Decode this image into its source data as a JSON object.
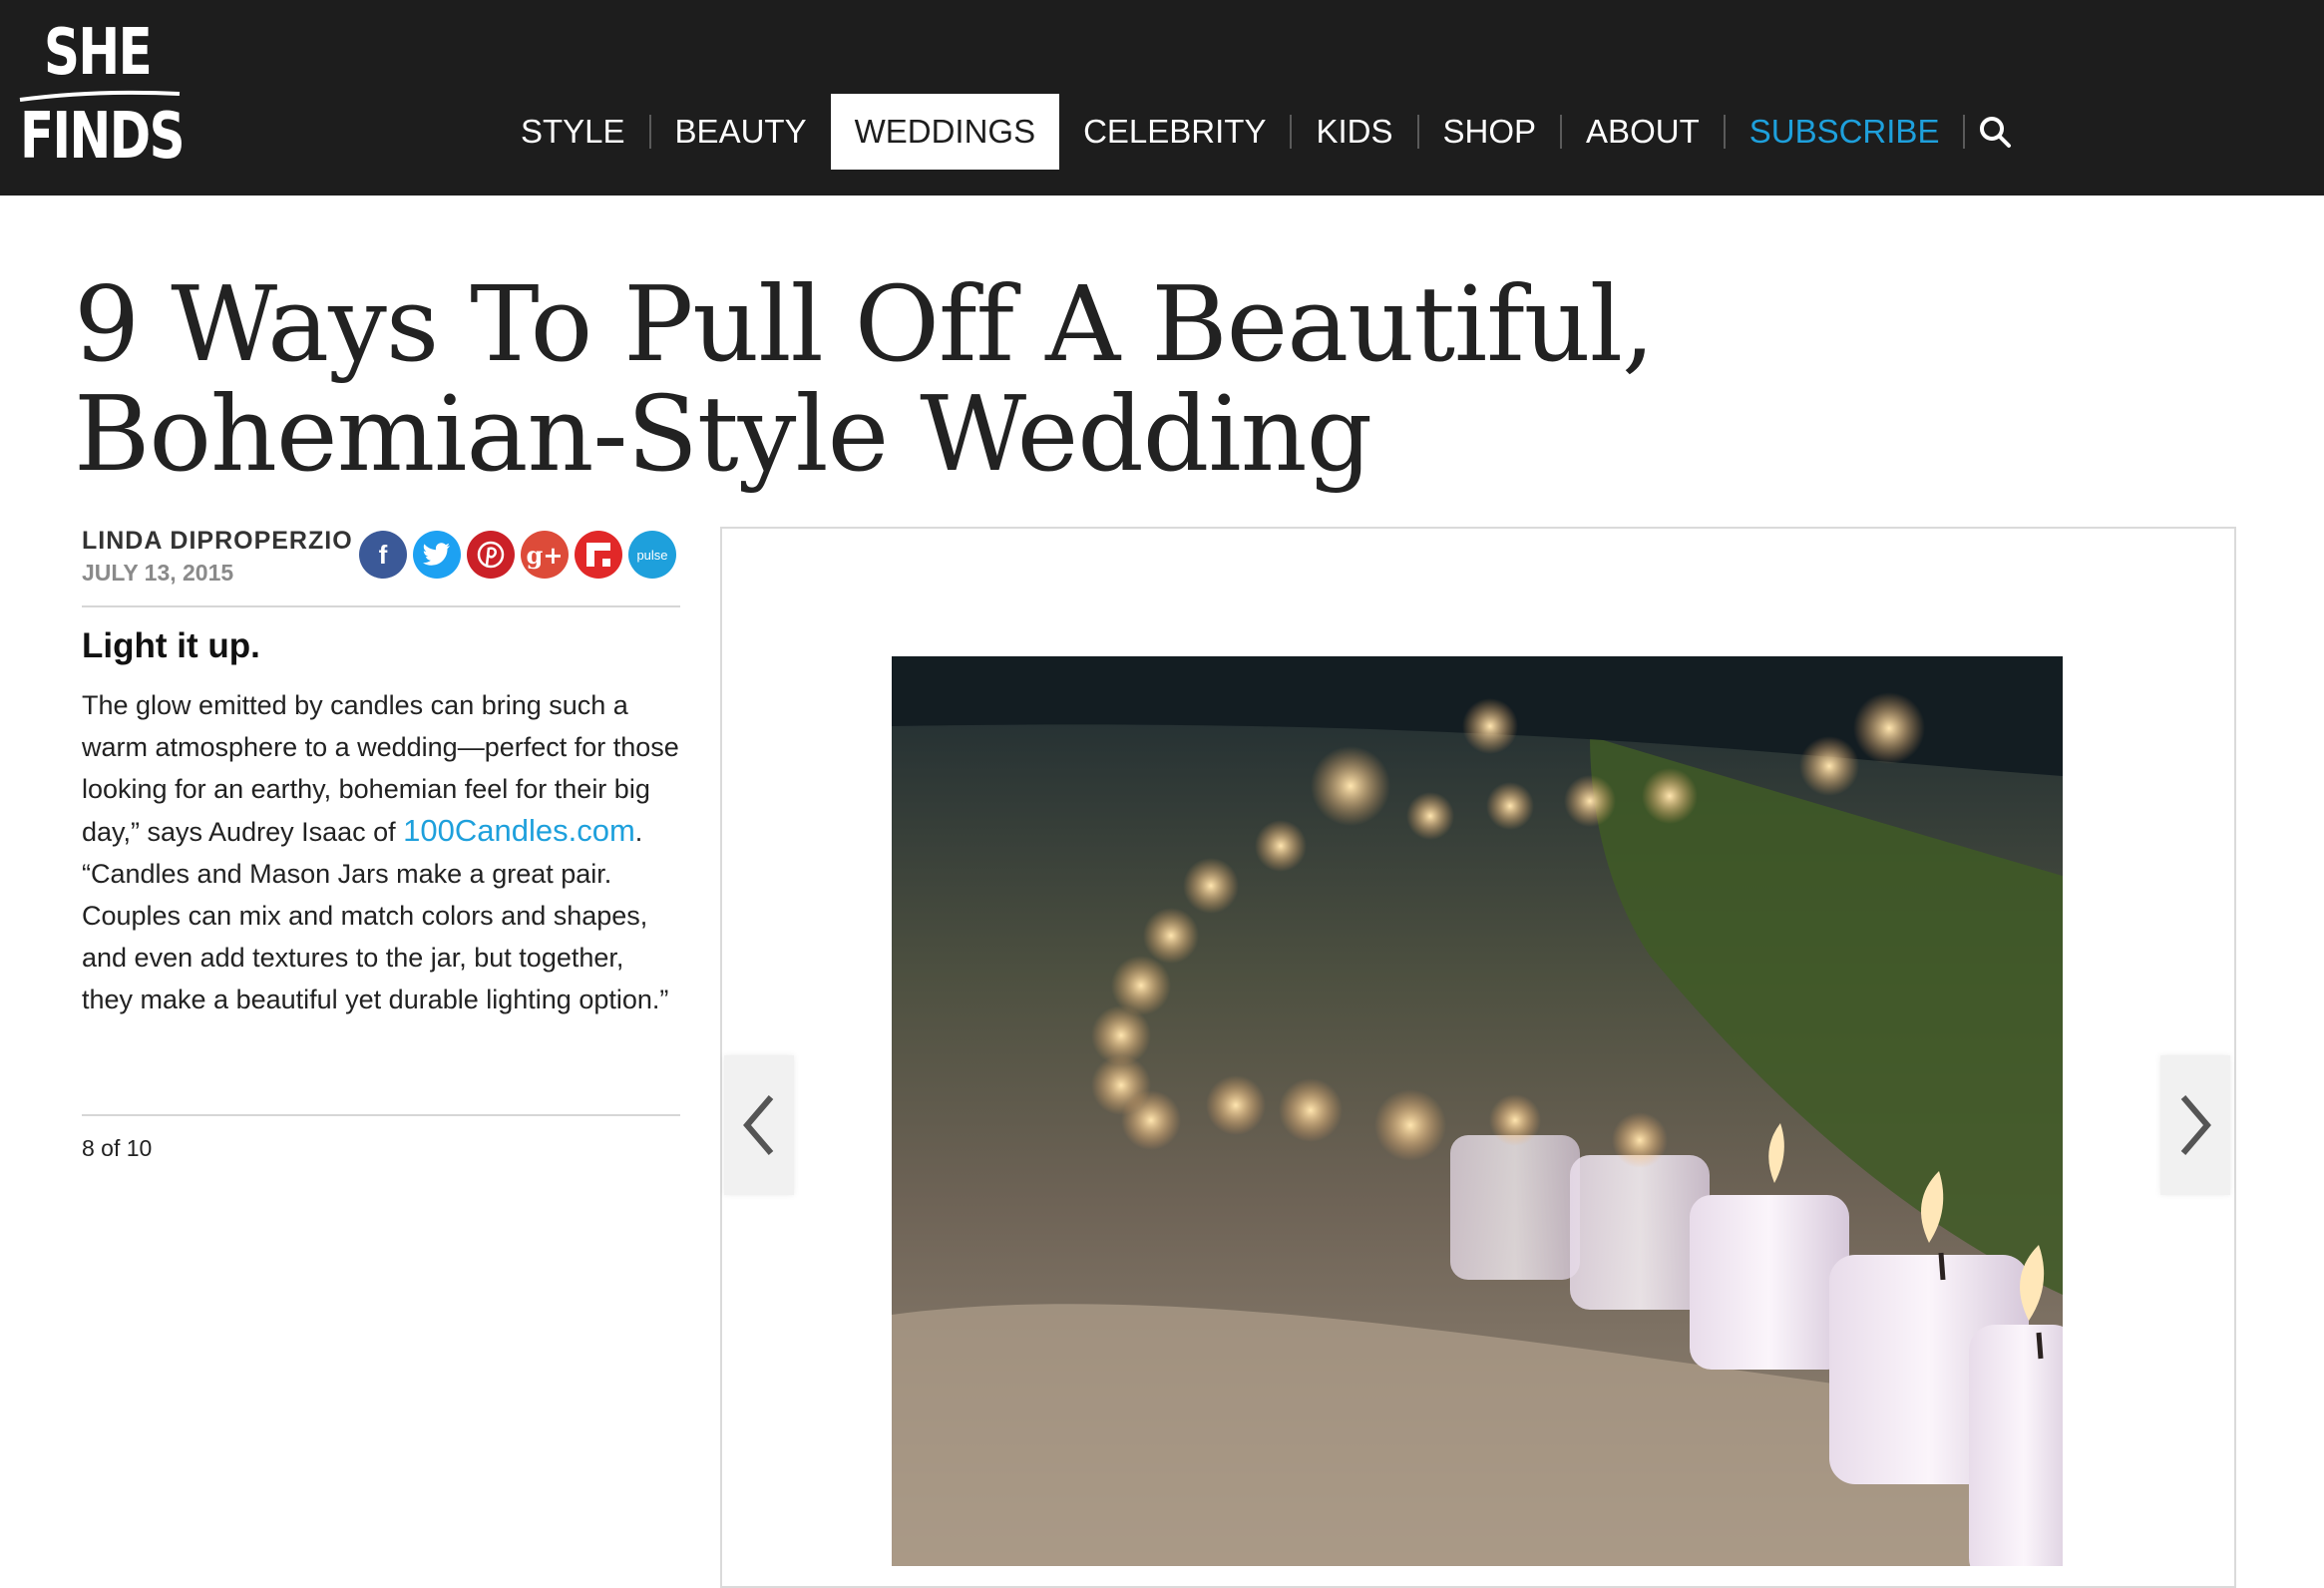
{
  "brand": {
    "line1": "SHE",
    "line2": "FINDS"
  },
  "nav": {
    "items": [
      {
        "label": "STYLE"
      },
      {
        "label": "BEAUTY"
      },
      {
        "label": "WEDDINGS",
        "active": true
      },
      {
        "label": "CELEBRITY"
      },
      {
        "label": "KIDS"
      },
      {
        "label": "SHOP"
      },
      {
        "label": "ABOUT"
      },
      {
        "label": "SUBSCRIBE"
      }
    ],
    "search_icon": "search-icon"
  },
  "article": {
    "title": "9 Ways To Pull Off A Beautiful, Bohemian-Style Wedding",
    "author": "LINDA DIPROPERZIO",
    "date": "JULY 13, 2015",
    "social": [
      {
        "icon": "facebook-icon",
        "glyph": "f",
        "color": "#3b5998"
      },
      {
        "icon": "twitter-icon",
        "glyph": "t",
        "color": "#1da1f2"
      },
      {
        "icon": "pinterest-icon",
        "glyph": "P",
        "color": "#cb2027"
      },
      {
        "icon": "google-plus-icon",
        "glyph": "g+",
        "color": "#dd4b39"
      },
      {
        "icon": "flipboard-icon",
        "glyph": "f",
        "color": "#e12828"
      },
      {
        "icon": "pulse-icon",
        "glyph": "pulse",
        "color": "#1ea0dc"
      }
    ],
    "slide": {
      "heading": "Light it up.",
      "caption_part1": "The glow emitted by candles can bring such a warm atmosphere to a wedding—perfect for those looking for an earthy, bohemian feel for their big day,” says Audrey Isaac of ",
      "caption_link": "100Candles.com",
      "caption_part2": ". “Candles and Mason Jars make a great pair. Couples can mix and match colors and shapes, and even add textures to the jar, but together, they make a beautiful yet durable lighting option.”",
      "counter": "8 of 10"
    }
  },
  "colors": {
    "header_bg": "#1d1d1d",
    "accent": "#1ea0dc"
  }
}
